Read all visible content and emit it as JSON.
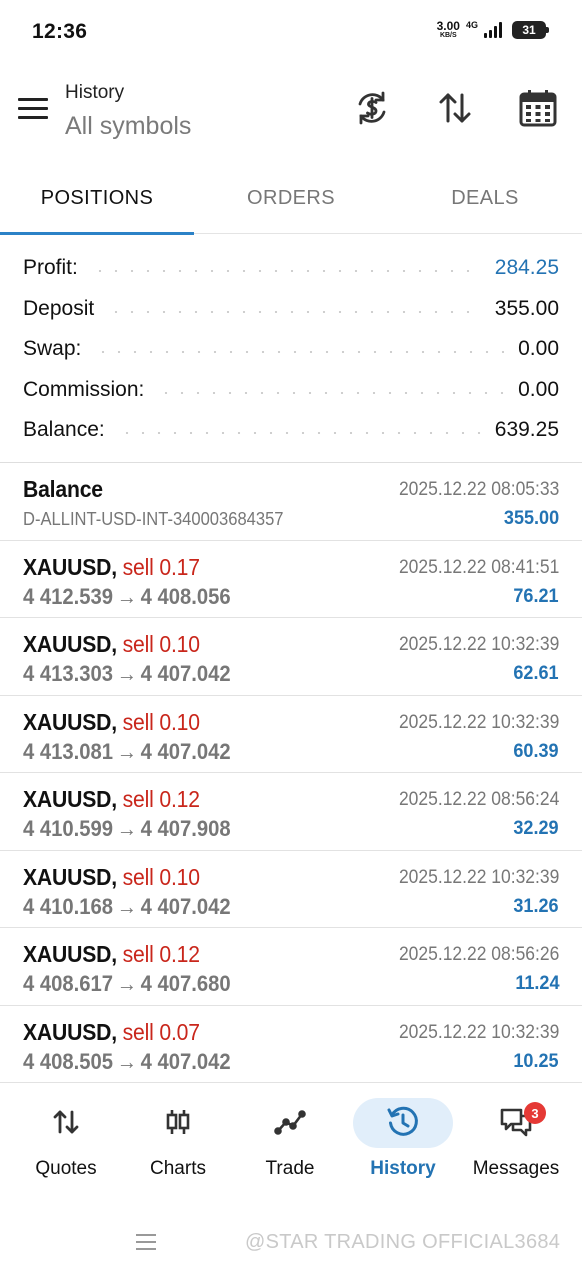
{
  "status_bar": {
    "time": "12:36",
    "net_speed": "3.00",
    "net_unit": "KB/S",
    "net_type": "4G",
    "battery": "31"
  },
  "header": {
    "title": "History",
    "subtitle": "All symbols",
    "icons": [
      "currency-sync-icon",
      "sort-icon",
      "calendar-icon"
    ]
  },
  "tabs": [
    {
      "label": "POSITIONS",
      "active": true
    },
    {
      "label": "ORDERS",
      "active": false
    },
    {
      "label": "DEALS",
      "active": false
    }
  ],
  "summary": {
    "profit": {
      "label": "Profit:",
      "value": "284.25"
    },
    "deposit": {
      "label": "Deposit",
      "value": "355.00"
    },
    "swap": {
      "label": "Swap:",
      "value": "0.00"
    },
    "commission": {
      "label": "Commission:",
      "value": "0.00"
    },
    "balance": {
      "label": "Balance:",
      "value": "639.25"
    }
  },
  "balance_entry": {
    "title": "Balance",
    "account": "D-ALLINT-USD-INT-340003684357",
    "time": "2025.12.22 08:05:33",
    "amount": "355.00"
  },
  "positions": [
    {
      "symbol": "XAUUSD",
      "side": "sell 0.17",
      "open": "4 412.539",
      "close": "4 408.056",
      "time": "2025.12.22 08:41:51",
      "profit": "76.21"
    },
    {
      "symbol": "XAUUSD",
      "side": "sell 0.10",
      "open": "4 413.303",
      "close": "4 407.042",
      "time": "2025.12.22 10:32:39",
      "profit": "62.61"
    },
    {
      "symbol": "XAUUSD",
      "side": "sell 0.10",
      "open": "4 413.081",
      "close": "4 407.042",
      "time": "2025.12.22 10:32:39",
      "profit": "60.39"
    },
    {
      "symbol": "XAUUSD",
      "side": "sell 0.12",
      "open": "4 410.599",
      "close": "4 407.908",
      "time": "2025.12.22 08:56:24",
      "profit": "32.29"
    },
    {
      "symbol": "XAUUSD",
      "side": "sell 0.10",
      "open": "4 410.168",
      "close": "4 407.042",
      "time": "2025.12.22 10:32:39",
      "profit": "31.26"
    },
    {
      "symbol": "XAUUSD",
      "side": "sell 0.12",
      "open": "4 408.617",
      "close": "4 407.680",
      "time": "2025.12.22 08:56:26",
      "profit": "11.24"
    },
    {
      "symbol": "XAUUSD",
      "side": "sell 0.07",
      "open": "4 408.505",
      "close": "4 407.042",
      "time": "2025.12.22 10:32:39",
      "profit": "10.25"
    }
  ],
  "arrow": "→",
  "bottom_nav": [
    {
      "label": "Quotes",
      "icon": "quotes-icon"
    },
    {
      "label": "Charts",
      "icon": "charts-icon"
    },
    {
      "label": "Trade",
      "icon": "trade-icon"
    },
    {
      "label": "History",
      "icon": "history-icon",
      "active": true
    },
    {
      "label": "Messages",
      "icon": "messages-icon",
      "badge": "3"
    }
  ],
  "watermark": "@STAR TRADING OFFICIAL3684",
  "colors": {
    "accent": "#2b82c7",
    "profit": "#2373b3",
    "sell": "#c9261b",
    "active_pill": "#e1eefa",
    "badge": "#e53935"
  }
}
